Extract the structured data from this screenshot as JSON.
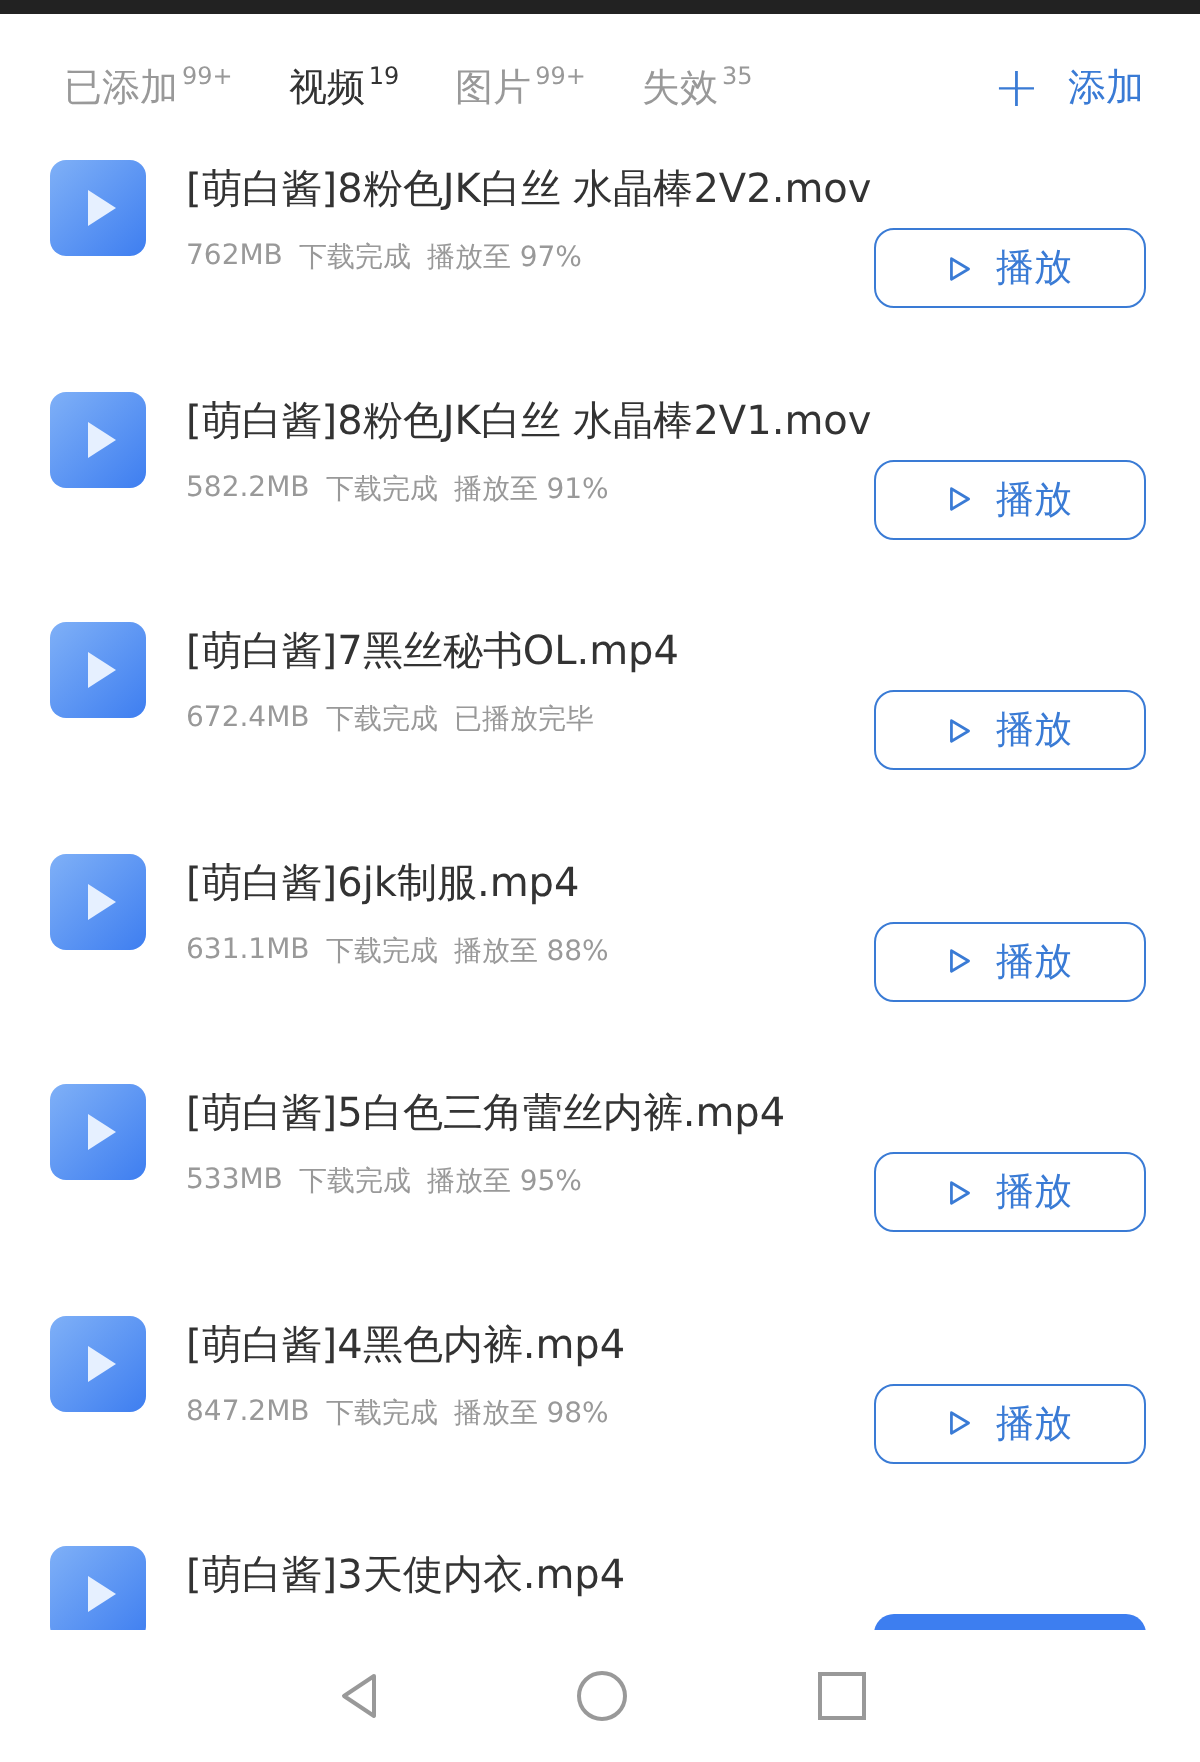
{
  "tabs": [
    {
      "label": "已添加",
      "count": "99+",
      "selected": false
    },
    {
      "label": "视频",
      "count": "19",
      "selected": true
    },
    {
      "label": "图片",
      "count": "99+",
      "selected": false
    },
    {
      "label": "失效",
      "count": "35",
      "selected": false
    }
  ],
  "add_button": {
    "icon": "+",
    "label": "添加"
  },
  "files": [
    {
      "title": "[萌白酱]8粉色JK白丝 水晶棒2V2.mov",
      "size": "762MB",
      "status": "下载完成",
      "progress": "播放至 97%",
      "kind": "play",
      "button": "播放"
    },
    {
      "title": "[萌白酱]8粉色JK白丝 水晶棒2V1.mov",
      "size": "582.2MB",
      "status": "下载完成",
      "progress": "播放至 91%",
      "kind": "play",
      "button": "播放"
    },
    {
      "title": "[萌白酱]7黑丝秘书OL.mp4",
      "size": "672.4MB",
      "status": "下载完成",
      "progress": "已播放完毕",
      "kind": "play",
      "button": "播放"
    },
    {
      "title": "[萌白酱]6jk制服.mp4",
      "size": "631.1MB",
      "status": "下载完成",
      "progress": "播放至 88%",
      "kind": "play",
      "button": "播放"
    },
    {
      "title": "[萌白酱]5白色三角蕾丝内裤.mp4",
      "size": "533MB",
      "status": "下载完成",
      "progress": "播放至 95%",
      "kind": "play",
      "button": "播放"
    },
    {
      "title": "[萌白酱]4黑色内裤.mp4",
      "size": "847.2MB",
      "status": "下载完成",
      "progress": "播放至 98%",
      "kind": "play",
      "button": "播放"
    },
    {
      "title": "[萌白酱]3天使内衣.mp4",
      "kind": "pending"
    }
  ]
}
